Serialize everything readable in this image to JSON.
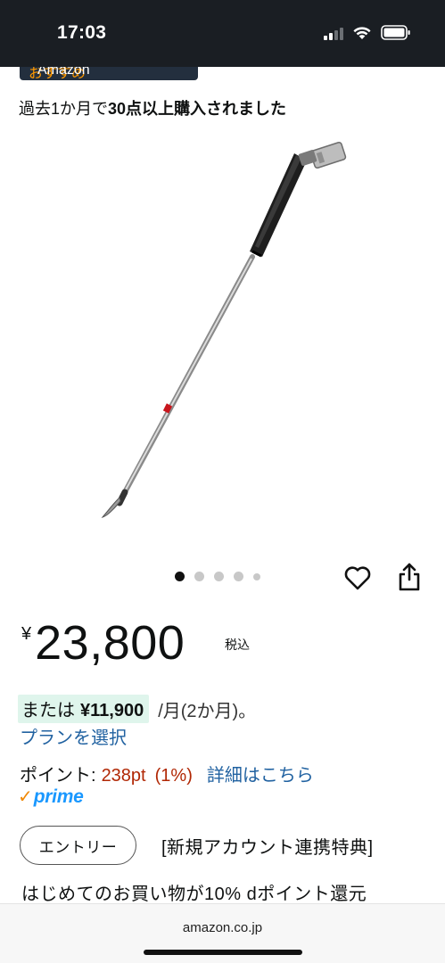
{
  "status_bar": {
    "time": "17:03",
    "icons": [
      "signal-icon",
      "wifi-icon",
      "battery-icon"
    ]
  },
  "banner": {
    "brand": "Amazon",
    "suffix": "おすすめ"
  },
  "purchase_info": {
    "prefix": "過去1か月で",
    "highlight": "30点以上購入されました"
  },
  "carousel": {
    "image_count": 5,
    "active_index": 0
  },
  "actions": {
    "favorite_icon": "heart-icon",
    "share_icon": "share-icon"
  },
  "price": {
    "symbol": "¥",
    "value": "23,800",
    "tax_label": "税込"
  },
  "installment": {
    "prefix": "または",
    "amount": "¥11,900",
    "suffix": "/月(2か月)。",
    "plan_link": "プランを選択"
  },
  "points": {
    "label": "ポイント:",
    "value": "238pt",
    "percent": "(1%)",
    "detail_link": "詳細はこちら"
  },
  "prime": {
    "check": "✓",
    "label": "prime"
  },
  "promotion": {
    "button_label": "エントリー",
    "title": "[新規アカウント連携特典]",
    "description": "はじめてのお買い物が10% dポイント還元"
  },
  "browser": {
    "url": "amazon.co.jp"
  },
  "colors": {
    "status_bar_bg": "#1a1e23",
    "link": "#2162a1",
    "points_red": "#b12704",
    "highlight_bg": "#dff5ec",
    "prime_blue": "#1a98ff",
    "prime_orange": "#f08804"
  }
}
